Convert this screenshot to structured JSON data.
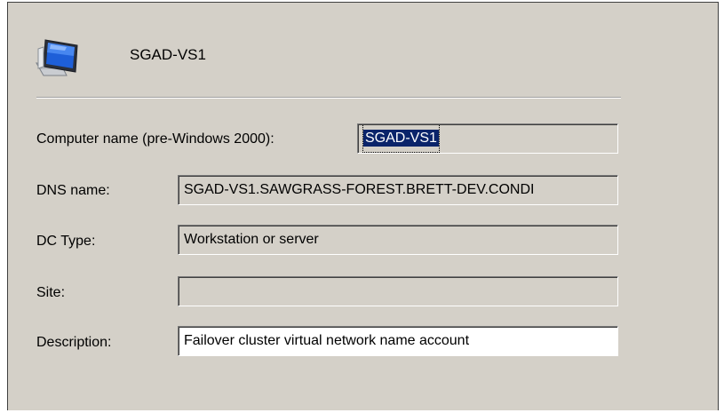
{
  "header": {
    "title": "SGAD-VS1",
    "icon": "computer-monitor-icon"
  },
  "fields": {
    "computer_name_label": "Computer name (pre-Windows 2000):",
    "computer_name_value": "SGAD-VS1",
    "dns_name_label": "DNS name:",
    "dns_name_value": "SGAD-VS1.SAWGRASS-FOREST.BRETT-DEV.CONDI",
    "dc_type_label": "DC Type:",
    "dc_type_value": "Workstation or server",
    "site_label": "Site:",
    "site_value": "",
    "description_label": "Description:",
    "description_value": "Failover cluster virtual network name account"
  },
  "colors": {
    "dialog_background": "#d4d0c8",
    "selection": "#0a246a",
    "editable_field": "#ffffff"
  }
}
